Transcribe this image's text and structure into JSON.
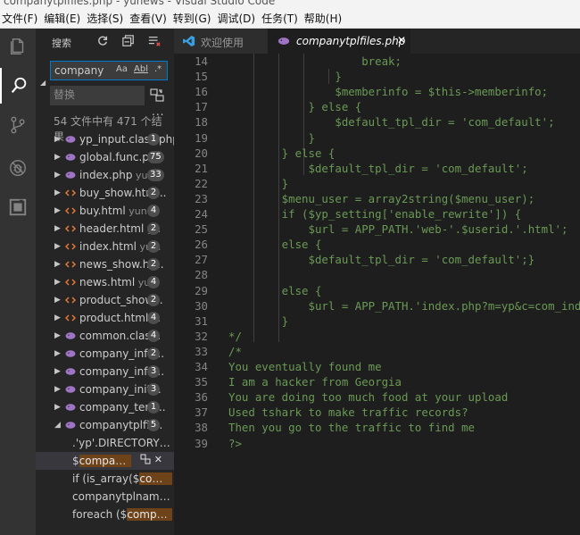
{
  "titlebar": {
    "text": "companytplfiles.php - yunews - Visual Studio Code"
  },
  "menubar": {
    "items": [
      "文件(F)",
      "编辑(E)",
      "选择(S)",
      "查看(V)",
      "转到(G)",
      "调试(D)",
      "任务(T)",
      "帮助(H)"
    ]
  },
  "activitybar": {
    "icons": [
      "files-icon",
      "search-icon",
      "source-control-icon",
      "debug-icon",
      "extensions-icon"
    ]
  },
  "sidebar": {
    "title": "搜索",
    "search": {
      "value": "company",
      "match_case": "Aa",
      "whole_word": "Abl",
      "regex": ".*"
    },
    "replace": {
      "placeholder": "替换"
    },
    "more": "...",
    "summary": "54 文件中有 471 个结果",
    "files": [
      {
        "name": "yp_input.class.php",
        "path": "",
        "count": "1",
        "type": "php"
      },
      {
        "name": "global.func.php",
        "path": "",
        "count": "75",
        "type": "php"
      },
      {
        "name": "index.php",
        "path": " yu...",
        "count": "33",
        "type": "php"
      },
      {
        "name": "buy_show.htm...",
        "path": "",
        "count": "2",
        "type": "html"
      },
      {
        "name": "buy.html",
        "path": " yun...",
        "count": "4",
        "type": "html"
      },
      {
        "name": "header.html",
        "path": " y...",
        "count": "2",
        "type": "html"
      },
      {
        "name": "index.html",
        "path": " yu...",
        "count": "2",
        "type": "html"
      },
      {
        "name": "news_show.ht...",
        "path": "",
        "count": "2",
        "type": "html"
      },
      {
        "name": "news.html",
        "path": " yu...",
        "count": "4",
        "type": "html"
      },
      {
        "name": "product_show...",
        "path": "",
        "count": "2",
        "type": "html"
      },
      {
        "name": "product.html",
        "path": " ...",
        "count": "4",
        "type": "html"
      },
      {
        "name": "common.clas...",
        "path": "",
        "count": "4",
        "type": "php"
      },
      {
        "name": "company_info...",
        "path": "",
        "count": "2",
        "type": "php"
      },
      {
        "name": "company_info...",
        "path": "",
        "count": "3",
        "type": "php"
      },
      {
        "name": "company_init...",
        "path": "",
        "count": "3",
        "type": "php"
      },
      {
        "name": "company_tem...",
        "path": "",
        "count": "1",
        "type": "php"
      },
      {
        "name": "companytplfil...",
        "path": "",
        "count": "5",
        "type": "php"
      }
    ],
    "matches": [
      {
        "pre": ".'yp'.DIRECTORY_SEP...",
        "hit": "",
        "post": ""
      },
      {
        "pre": "$",
        "hit": "companyt",
        "post": "..."
      },
      {
        "pre": "if (is_array($",
        "hit": "compan",
        "post": "..."
      },
      {
        "pre": "companytplnames) ...",
        "hit": "",
        "post": ""
      },
      {
        "pre": "foreach ($",
        "hit": "companyt",
        "post": "..."
      }
    ]
  },
  "tabs": [
    {
      "label": "欢迎使用",
      "icon": "vscode-icon"
    },
    {
      "label": "companytplfiles.php",
      "icon": "php-icon",
      "close": "✕"
    }
  ],
  "code": {
    "lines": [
      {
        "n": "14",
        "t": "                    break;"
      },
      {
        "n": "15",
        "t": "                }"
      },
      {
        "n": "16",
        "t": "                $memberinfo = $this->memberinfo;"
      },
      {
        "n": "17",
        "t": "            } else {"
      },
      {
        "n": "18",
        "t": "                $default_tpl_dir = 'com_default';"
      },
      {
        "n": "19",
        "t": "            }"
      },
      {
        "n": "20",
        "t": "        } else {"
      },
      {
        "n": "21",
        "t": "            $default_tpl_dir = 'com_default';"
      },
      {
        "n": "22",
        "t": "        }"
      },
      {
        "n": "23",
        "t": "        $menu_user = array2string($menu_user);"
      },
      {
        "n": "24",
        "t": "        if ($yp_setting['enable_rewrite']) {"
      },
      {
        "n": "25",
        "t": "            $url = APP_PATH.'web-'.$userid.'.html';"
      },
      {
        "n": "26",
        "t": "        else {"
      },
      {
        "n": "27",
        "t": "            $default_tpl_dir = 'com_default';}"
      },
      {
        "n": "28",
        "t": ""
      },
      {
        "n": "29",
        "t": "        else {"
      },
      {
        "n": "30",
        "t": "            $url = APP_PATH.'index.php?m=yp&c=com_index"
      },
      {
        "n": "31",
        "t": "        }"
      },
      {
        "n": "32",
        "t": "*/"
      },
      {
        "n": "33",
        "t": "/*"
      },
      {
        "n": "34",
        "t": "You eventually found me"
      },
      {
        "n": "35",
        "t": "I am a hacker from Georgia"
      },
      {
        "n": "36",
        "t": "You are doing too much food at your upload"
      },
      {
        "n": "37",
        "t": "Used tshark to make traffic records?"
      },
      {
        "n": "38",
        "t": "Then you go to the traffic to find me"
      },
      {
        "n": "39",
        "t": "?>"
      }
    ]
  },
  "colors": {
    "comment": "#6a9955",
    "line_number": "#858585",
    "match_highlight": "#6f4319",
    "accent": "#007acc"
  }
}
